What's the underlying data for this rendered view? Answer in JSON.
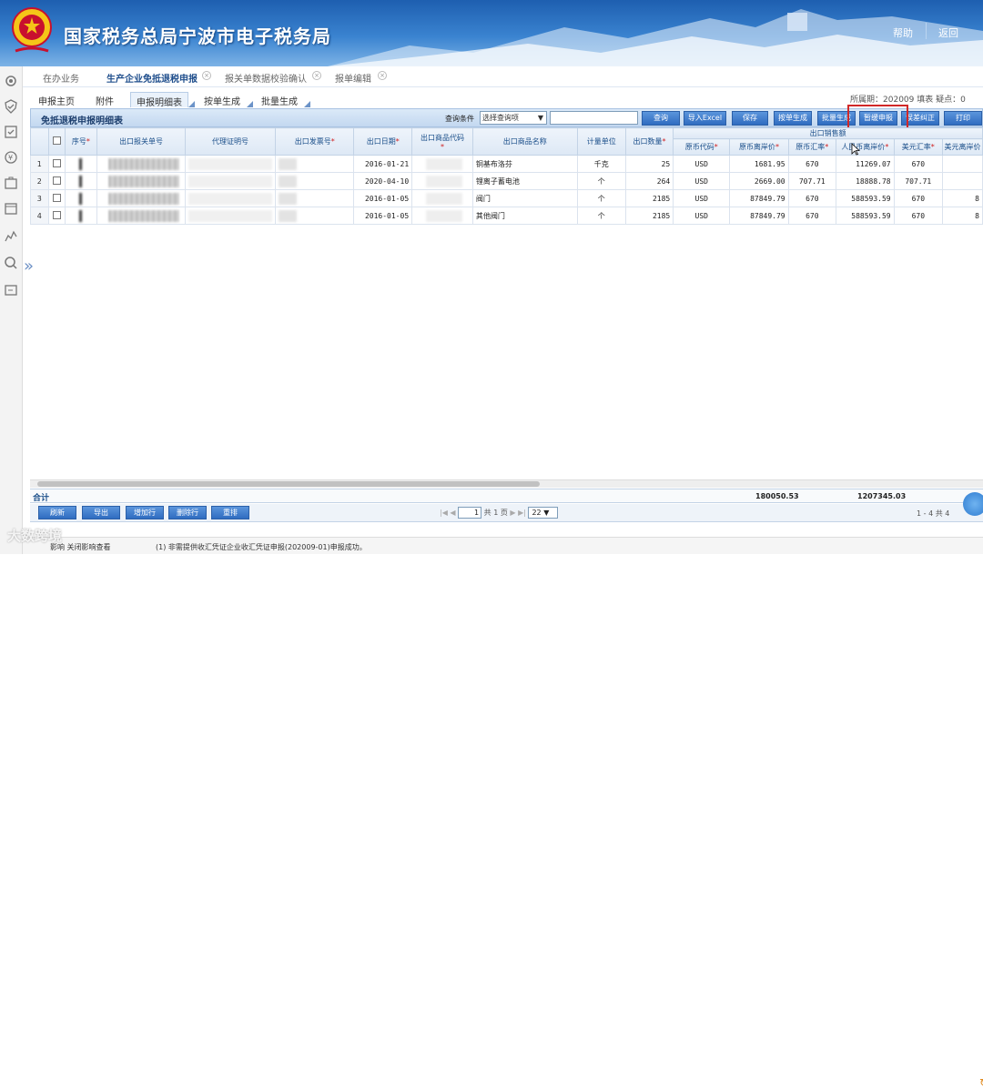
{
  "header": {
    "title": "国家税务总局宁波市电子税务局",
    "help": "帮助",
    "back": "返回"
  },
  "topnav": [
    {
      "label": "在办业务",
      "active": false,
      "closable": false
    },
    {
      "label": "生产企业免抵退税申报",
      "active": true,
      "closable": true
    },
    {
      "label": "报关单数据校验确认",
      "active": false,
      "closable": true
    },
    {
      "label": "报单编辑",
      "active": false,
      "closable": true
    }
  ],
  "subtabs": [
    {
      "label": "申报主页",
      "active": false
    },
    {
      "label": "附件",
      "active": false
    },
    {
      "label": "申报明细表",
      "active": true
    },
    {
      "label": "按单生成",
      "active": false
    },
    {
      "label": "批量生成",
      "active": false
    }
  ],
  "period": {
    "label": "所属期：",
    "value": "202009",
    "fill_label": "填表",
    "doubt_label": "疑点：0"
  },
  "toolbar": {
    "title": "免抵退税申报明细表",
    "query_label": "查询条件",
    "query_select": "选择查询项",
    "buttons": [
      "查询",
      "导入Excel",
      "保存",
      "按单生成",
      "批量生成",
      "暂缓申报",
      "误差纠正",
      "打印"
    ]
  },
  "table": {
    "group_header": "出口销售额",
    "columns": [
      {
        "label": "序号",
        "required": true
      },
      {
        "label": "出口报关单号",
        "required": false
      },
      {
        "label": "代理证明号",
        "required": false
      },
      {
        "label": "出口发票号",
        "required": true
      },
      {
        "label": "出口日期",
        "required": true
      },
      {
        "label": "出口商品代码",
        "required": true
      },
      {
        "label": "出口商品名称",
        "required": false
      },
      {
        "label": "计量单位",
        "required": false
      },
      {
        "label": "出口数量",
        "required": true
      },
      {
        "label": "原币代码",
        "required": true
      },
      {
        "label": "原币离岸价",
        "required": true
      },
      {
        "label": "原币汇率",
        "required": true
      },
      {
        "label": "人民币离岸价",
        "required": true
      },
      {
        "label": "美元汇率",
        "required": true
      },
      {
        "label": "美元离岸价",
        "required": false
      }
    ],
    "rows": [
      {
        "no": "1",
        "date": "2016-01-21",
        "name": "铜基布洛芬",
        "unit": "千克",
        "qty": "25",
        "currency": "USD",
        "fob": "1681.95",
        "rate": "670",
        "rmb": "11269.07",
        "usd_rate": "670",
        "usd_fob": ""
      },
      {
        "no": "2",
        "date": "2020-04-10",
        "name": "锂离子蓄电池",
        "unit": "个",
        "qty": "264",
        "currency": "USD",
        "fob": "2669.00",
        "rate": "707.71",
        "rmb": "18888.78",
        "usd_rate": "707.71",
        "usd_fob": ""
      },
      {
        "no": "3",
        "date": "2016-01-05",
        "name": "阀门",
        "unit": "个",
        "qty": "2185",
        "currency": "USD",
        "fob": "87849.79",
        "rate": "670",
        "rmb": "588593.59",
        "usd_rate": "670",
        "usd_fob": "8"
      },
      {
        "no": "4",
        "date": "2016-01-05",
        "name": "其他阀门",
        "unit": "个",
        "qty": "2185",
        "currency": "USD",
        "fob": "87849.79",
        "rate": "670",
        "rmb": "588593.59",
        "usd_rate": "670",
        "usd_fob": "8"
      }
    ]
  },
  "totals": {
    "label": "合计",
    "fob_total": "180050.53",
    "rmb_total": "1207345.03"
  },
  "bottom_buttons": [
    "刷新",
    "导出",
    "增加行",
    "删除行",
    "重排"
  ],
  "pager": {
    "page": "1",
    "of_prefix": "共",
    "total_pages": "1",
    "page_suffix": "页",
    "page_size": "22",
    "info": "1 - 4  共 4"
  },
  "status": {
    "left": "影响  关闭影响查看",
    "message": "(1)  非需提供收汇凭证企业收汇凭证申报(202009-01)申报成功。"
  },
  "watermark": "大数跨境"
}
